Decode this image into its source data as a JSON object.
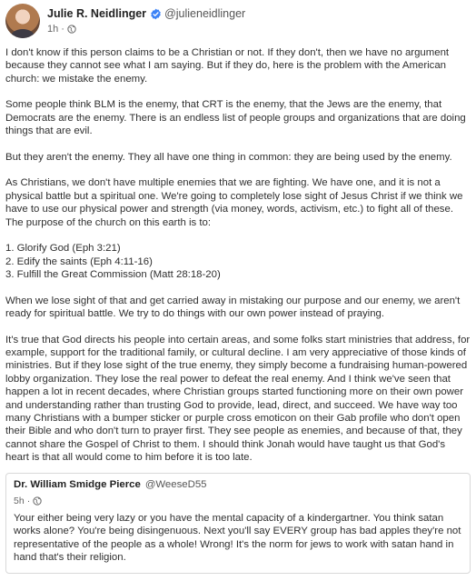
{
  "post": {
    "author_name": "Julie R. Neidlinger",
    "author_handle": "@julieneidlinger",
    "time": "1h",
    "separator": "·",
    "paragraphs": [
      "I don't know if this person claims to be a Christian or not. If they don't, then we have no argument because they cannot see what I am saying. But if they do, here is the problem with the American church: we mistake the enemy.",
      "Some people think BLM is the enemy, that CRT is the enemy, that the Jews are the enemy, that Democrats are the enemy. There is an endless list of people groups and organizations that are doing things that are evil.",
      "But they aren't the enemy. They all have one thing in common: they are being used by the enemy.",
      "As Christians, we don't have multiple enemies that we are fighting. We have one, and it is not a physical battle but a spiritual one. We're going to completely lose sight of Jesus Christ if we think we have to use our physical power and strength (via money, words, activism, etc.) to fight all of these. The purpose of the church on this earth is to:"
    ],
    "list": [
      "1. Glorify God (Eph 3:21)",
      "2. Edify the saints (Eph 4:11-16)",
      "3. Fulfill the Great Commission (Matt 28:18-20)"
    ],
    "paragraphs_after": [
      "When we lose sight of that and get carried away in mistaking our purpose and our enemy, we aren't ready for spiritual battle. We try to do things with our own power instead of praying.",
      "It's true that God directs his people into certain areas, and some folks start ministries that address, for example, support for the traditional family, or cultural decline. I am very appreciative of those kinds of ministries. But if they lose sight of the true enemy, they simply become a fundraising human-powered lobby organization. They lose the real power to defeat the real enemy. And I think we've seen that happen a lot in recent decades, where Christian groups started functioning more on their own power and understanding rather than trusting God to provide, lead, direct, and succeed. We have way too many Christians with a bumper sticker or purple cross emoticon on their Gab profile who don't open their Bible and who don't turn to prayer first. They see people as enemies, and because of that, they cannot share the Gospel of Christ to them. I should think Jonah would have taught us that God's heart is that all would come to him before it is too late."
    ]
  },
  "quoted": {
    "author_name": "Dr. William Smidge Pierce",
    "author_handle": "@WeeseD55",
    "time": "5h",
    "separator": "·",
    "text": "Your either being very lazy or you have the mental capacity of a kindergartner. You think satan works alone? You're being disingenuous. Next you'll say EVERY group has bad apples they're not representative of the people as a whole! Wrong! It's the norm for jews to work with satan hand in hand that's their religion."
  },
  "icons": {
    "verified": "verified-badge-icon",
    "visibility": "globe-icon"
  },
  "colors": {
    "verified": "#3b82f6",
    "text": "#2f2f2f",
    "muted": "#666666",
    "border": "#d9d9d9"
  }
}
